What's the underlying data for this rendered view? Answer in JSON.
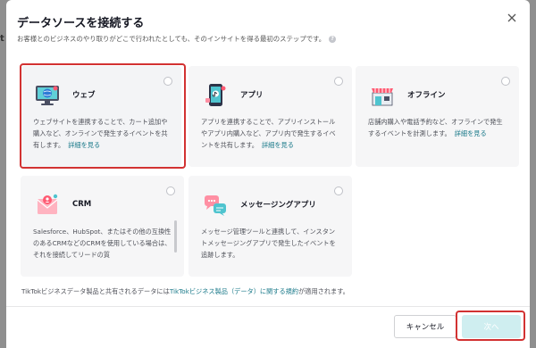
{
  "backdrop": {
    "fragment": "t"
  },
  "dialog": {
    "title": "データソースを接続する",
    "subtitle": "お客様とのビジネスのやり取りがどこで行われたとしても、そのインサイトを得る最初のステップです。",
    "help_icon": "?"
  },
  "cards": [
    {
      "key": "web",
      "name": "ウェブ",
      "icon": "monitor-globe-icon",
      "description": "ウェブサイトを連携することで、カート追加や購入など、オンラインで発生するイベントを共有します。",
      "more": "詳細を見る",
      "selected": false
    },
    {
      "key": "app",
      "name": "アプリ",
      "icon": "phone-app-icon",
      "description": "アプリを連携することで、アプリインストールやアプリ内購入など、アプリ内で発生するイベントを共有します。",
      "more": "詳細を見る",
      "selected": false
    },
    {
      "key": "offline",
      "name": "オフライン",
      "icon": "storefront-icon",
      "description": "店舗内購入や電話予約など、オフラインで発生するイベントを計測します。",
      "more": "詳細を見る",
      "selected": false
    },
    {
      "key": "crm",
      "name": "CRM",
      "icon": "crm-envelope-icon",
      "description": "Salesforce、HubSpot、またはその他の互換性のあるCRMなどのCRMを使用している場合は、それを接続してリードの質",
      "more": "",
      "selected": false
    },
    {
      "key": "messaging",
      "name": "メッセージングアプリ",
      "icon": "chat-bubbles-icon",
      "description": "メッセージ管理ツールと連携して、インスタントメッセージングアプリで発生したイベントを追跡します。",
      "more": "",
      "selected": false
    }
  ],
  "footer": {
    "note_prefix": "TikTokビジネスデータ製品と共有されるデータには",
    "note_link": "TikTokビジネス製品（データ）に関する規約",
    "note_suffix": "が適用されます。",
    "cancel": "キャンセル",
    "next": "次へ"
  },
  "colors": {
    "accent": "#1b7a8a",
    "highlight": "#d23232",
    "next_disabled": "#cfeef0",
    "card_bg": "#f6f6f7"
  }
}
